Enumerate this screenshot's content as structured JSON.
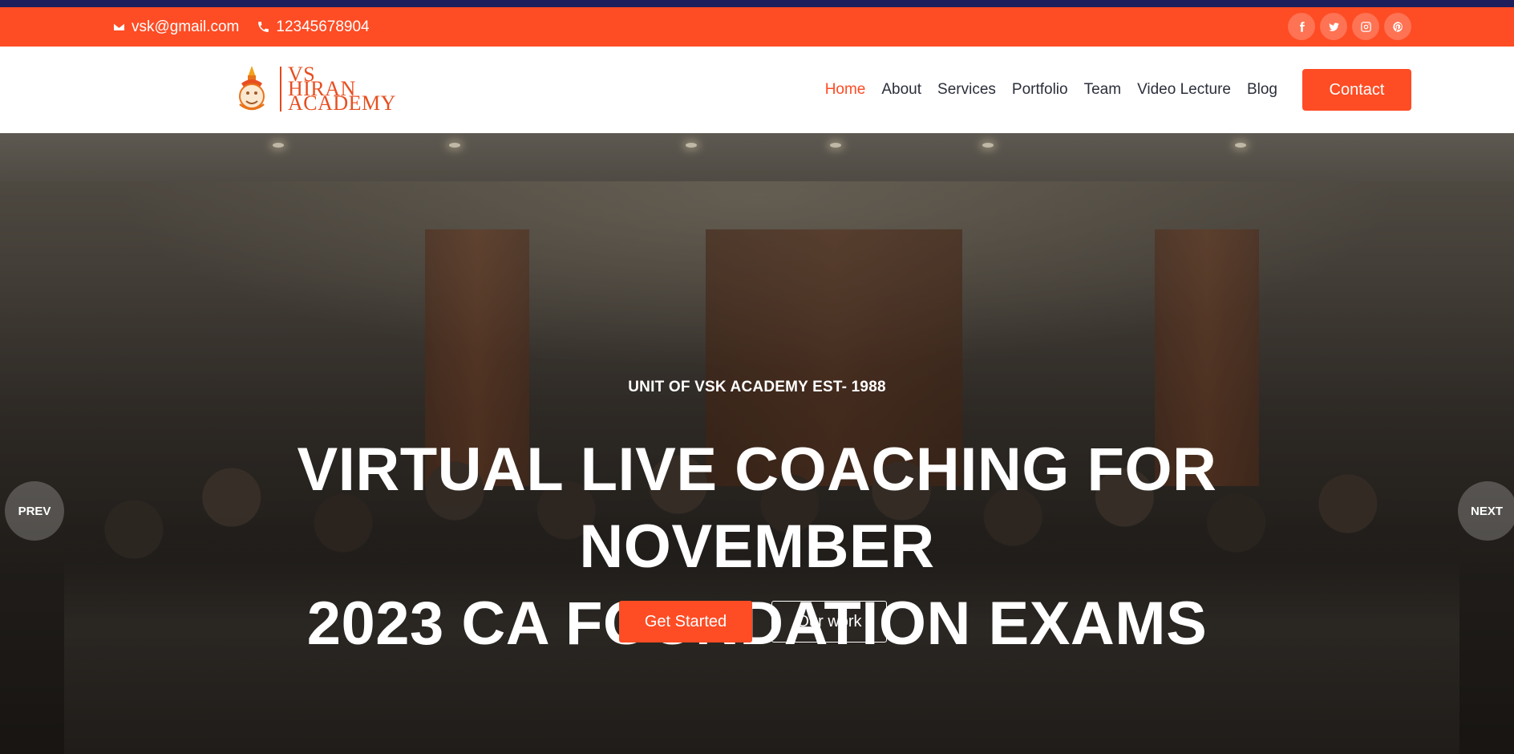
{
  "topbar": {
    "email": "vsk@gmail.com",
    "phone": "12345678904",
    "socials": [
      "facebook-icon",
      "twitter-icon",
      "instagram-icon",
      "pinterest-icon"
    ]
  },
  "logo": {
    "line1": "VS",
    "line2": "HIRAN",
    "line3": "ACADEMY"
  },
  "nav": {
    "items": [
      "Home",
      "About",
      "Services",
      "Portfolio",
      "Team",
      "Video Lecture",
      "Blog"
    ],
    "active": "Home",
    "contact_label": "Contact"
  },
  "hero": {
    "eyebrow": "UNIT OF VSK ACADEMY EST- 1988",
    "headline_line1": "VIRTUAL LIVE COACHING FOR NOVEMBER",
    "headline_line2": "2023 CA FOUNDATION EXAMS",
    "primary_cta": "Get Started",
    "secondary_cta": "Our work",
    "prev_label": "PREV",
    "next_label": "NEXT"
  },
  "colors": {
    "accent": "#fe4c24",
    "top_strip": "#1d1f5c",
    "nav_text": "#2b2f3a"
  }
}
